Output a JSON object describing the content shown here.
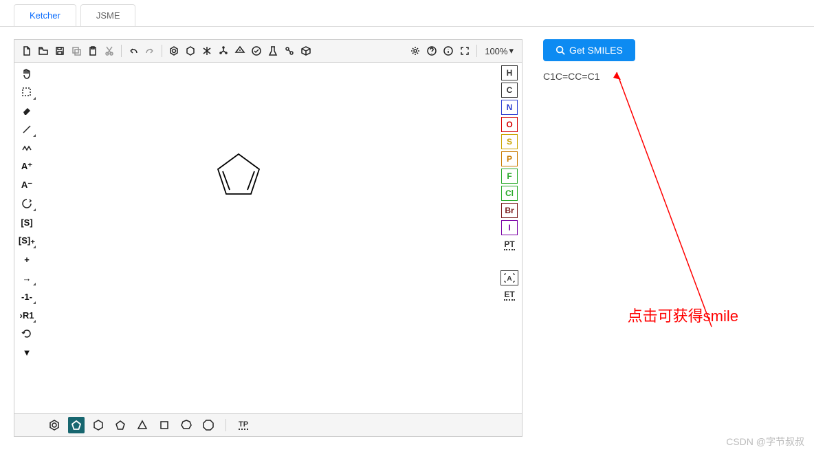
{
  "tabs": {
    "ketcher": "Ketcher",
    "jsme": "JSME"
  },
  "zoom_level": "100%",
  "right_atoms": [
    {
      "label": "H",
      "color": "#333333"
    },
    {
      "label": "C",
      "color": "#333333"
    },
    {
      "label": "N",
      "color": "#2d3fd1"
    },
    {
      "label": "O",
      "color": "#d40000"
    },
    {
      "label": "S",
      "color": "#c9a400"
    },
    {
      "label": "P",
      "color": "#c97a00"
    },
    {
      "label": "F",
      "color": "#2aa92a"
    },
    {
      "label": "Cl",
      "color": "#2aa92a"
    },
    {
      "label": "Br",
      "color": "#7a1a1a"
    },
    {
      "label": "I",
      "color": "#7a00a5"
    }
  ],
  "right_extra": {
    "pt": "PT",
    "sel": "A",
    "et": "ET"
  },
  "left_labels": {
    "charge_plus": "A⁺",
    "charge_minus": "A⁻",
    "sgroup": "[S]",
    "sgroup_plus": "[S]₊",
    "plus": "+",
    "arrow": "→",
    "text": "-1-",
    "rgroup": "›R1",
    "more": "▼"
  },
  "bottom_label": {
    "tp": "TP"
  },
  "side": {
    "button": "Get SMILES",
    "smiles_output": "C1C=CC=C1"
  },
  "annotation": "点击可获得smile",
  "watermark": "CSDN @字节叔叔"
}
